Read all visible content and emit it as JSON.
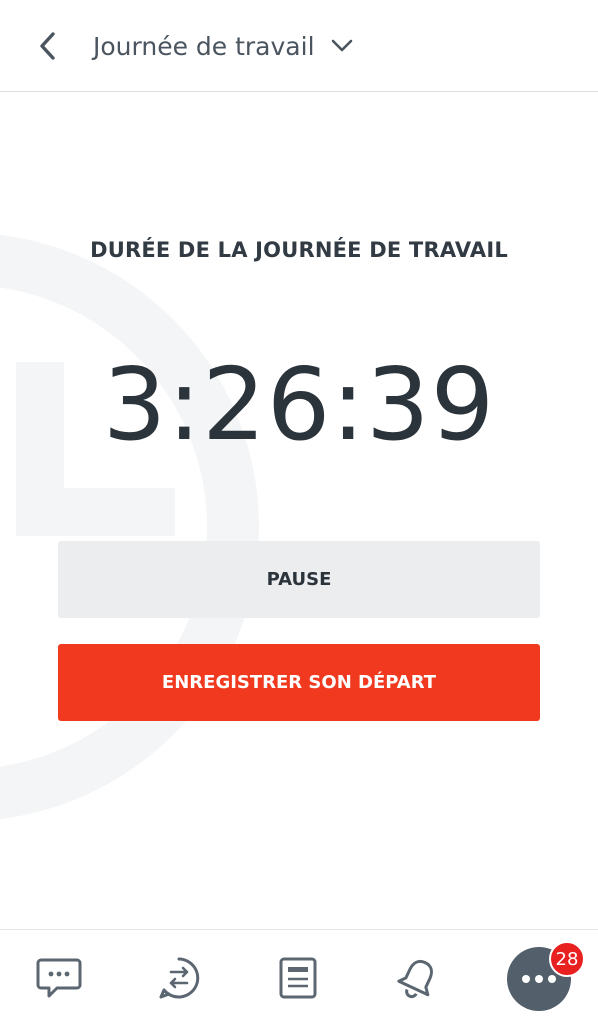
{
  "header": {
    "title": "Journée de travail",
    "back_icon": "chevron-left-icon",
    "dropdown_icon": "chevron-down-icon"
  },
  "workday": {
    "duration_label": "DURÉE DE LA JOURNÉE DE TRAVAIL",
    "elapsed_time": "3:26:39"
  },
  "actions": {
    "pause_label": "PAUSE",
    "checkout_label": "ENREGISTRER SON DÉPART"
  },
  "bottom_nav": {
    "items": [
      {
        "icon": "chat-bubble-icon"
      },
      {
        "icon": "conversations-icon"
      },
      {
        "icon": "feed-icon"
      },
      {
        "icon": "bell-icon"
      },
      {
        "icon": "more-icon"
      }
    ],
    "notification_count": "28"
  },
  "colors": {
    "accent": "#f0391e",
    "secondary_button": "#ebedef",
    "text_dark": "#2b333b",
    "badge": "#e8201f",
    "more_button": "#53606b"
  }
}
